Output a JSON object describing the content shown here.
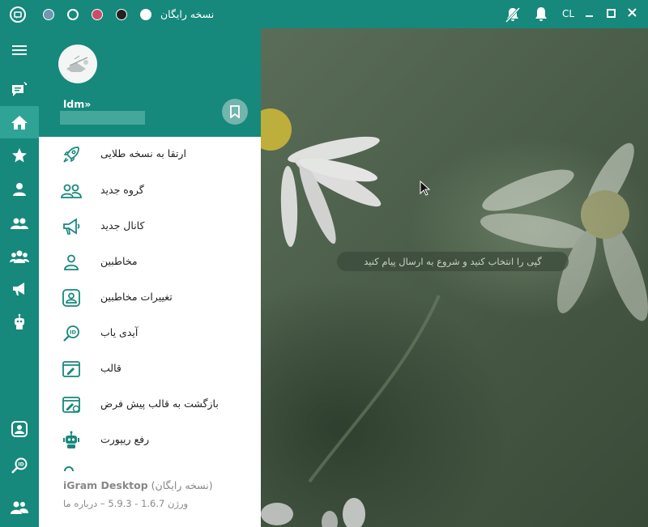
{
  "titlebar": {
    "title": "نسخه رایگان",
    "lang": "CL",
    "theme_colors": [
      "#ffffff",
      "#222222",
      "#c94d6a",
      "#16887c",
      "#6f97b0"
    ],
    "accent": "#16887c"
  },
  "sidebar": {
    "items": [
      {
        "icon": "menu-icon"
      },
      {
        "icon": "chats-icon"
      },
      {
        "icon": "home-icon",
        "active": true
      },
      {
        "icon": "star-icon"
      },
      {
        "icon": "user-icon"
      },
      {
        "icon": "group-icon"
      },
      {
        "icon": "supergroup-icon"
      },
      {
        "icon": "channel-icon"
      },
      {
        "icon": "bot-icon"
      },
      {
        "icon": "contacts-icon"
      },
      {
        "icon": "id-finder-icon"
      },
      {
        "icon": "users-icon"
      }
    ]
  },
  "drawer": {
    "profile": {
      "name": "ldm»"
    },
    "menu": [
      {
        "label": "ارتقا به نسخه طلایی",
        "icon": "rocket-icon"
      },
      {
        "label": "گروه جدید",
        "icon": "new-group-icon"
      },
      {
        "label": "کانال جدید",
        "icon": "new-channel-icon"
      },
      {
        "label": "مخاطبین",
        "icon": "contacts-person-icon"
      },
      {
        "label": "تغییرات مخاطبین",
        "icon": "contact-changes-icon"
      },
      {
        "label": "آیدی یاب",
        "icon": "id-search-icon"
      },
      {
        "label": "قالب",
        "icon": "theme-icon"
      },
      {
        "label": "بازگشت به قالب پیش فرض",
        "icon": "default-theme-icon"
      },
      {
        "label": "رفع ریپورت",
        "icon": "report-fix-icon"
      }
    ],
    "footer": {
      "app_name": "iGram Desktop",
      "edition": "(نسخه رایگان)",
      "version": "ورژن 1.6.7 - 5.9.3 – درباره ما"
    }
  },
  "chat": {
    "empty_hint": "گپی را انتخاب کنید و شروع به ارسال پیام کنید"
  }
}
